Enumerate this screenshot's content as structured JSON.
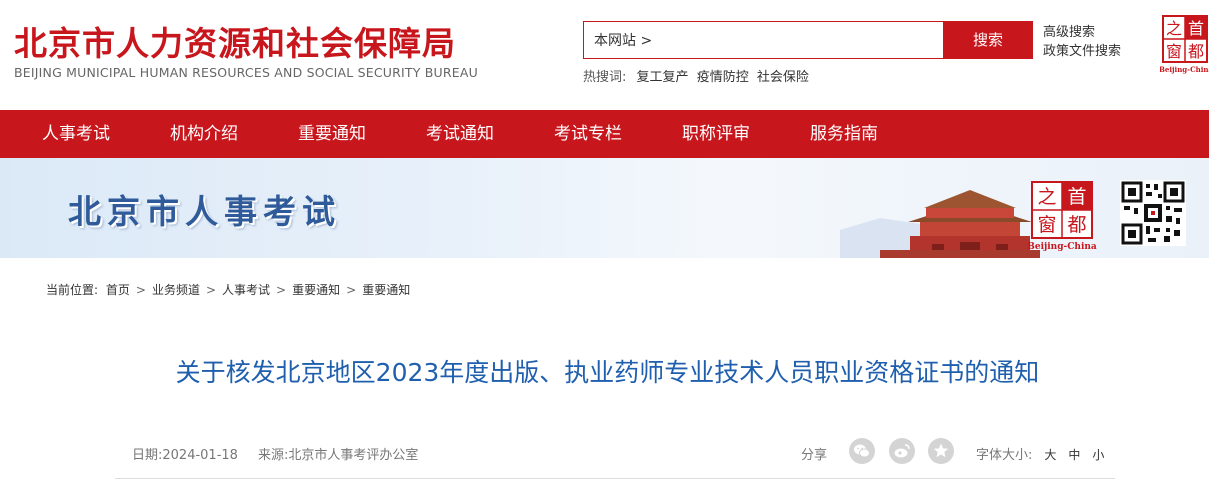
{
  "header": {
    "title": "北京市人力资源和社会保障局",
    "subtitle": "BEIJING MUNICIPAL HUMAN RESOURCES AND SOCIAL SECURITY BUREAU",
    "search": {
      "value": "本网站 >",
      "button_label": "搜索"
    },
    "adv_links": [
      "高级搜索",
      "政策文件搜索"
    ],
    "hot_search": {
      "label": "热搜词:",
      "items": [
        "复工复产",
        "疫情防控",
        "社会保险"
      ]
    },
    "logo": {
      "chars": [
        "首",
        "都",
        "之",
        "窗"
      ],
      "caption": "Beijing-China"
    }
  },
  "nav": {
    "items": [
      "人事考试",
      "机构介绍",
      "重要通知",
      "考试通知",
      "考试专栏",
      "职称评审",
      "服务指南"
    ]
  },
  "banner": {
    "title": "北京市人事考试",
    "logo_chars": [
      "首",
      "都",
      "之",
      "窗"
    ],
    "logo_caption": "Beijing-China"
  },
  "breadcrumb": {
    "label": "当前位置:",
    "items": [
      "首页",
      "业务频道",
      "人事考试",
      "重要通知",
      "重要通知"
    ]
  },
  "article": {
    "title": "关于核发北京地区2023年度出版、执业药师专业技术人员职业资格证书的通知",
    "date_label": "日期:",
    "date": "2024-01-18",
    "source_label": "来源:",
    "source": "北京市人事考评办公室",
    "share_label": "分享",
    "share_icons": [
      "wechat-icon",
      "weibo-icon",
      "star-icon"
    ],
    "font_size_label": "字体大小:",
    "font_sizes": [
      "大",
      "中",
      "小"
    ]
  },
  "colors": {
    "brand_red": "#c8161d",
    "title_blue": "#1f5fae",
    "banner_blue": "#2f5b9a"
  }
}
